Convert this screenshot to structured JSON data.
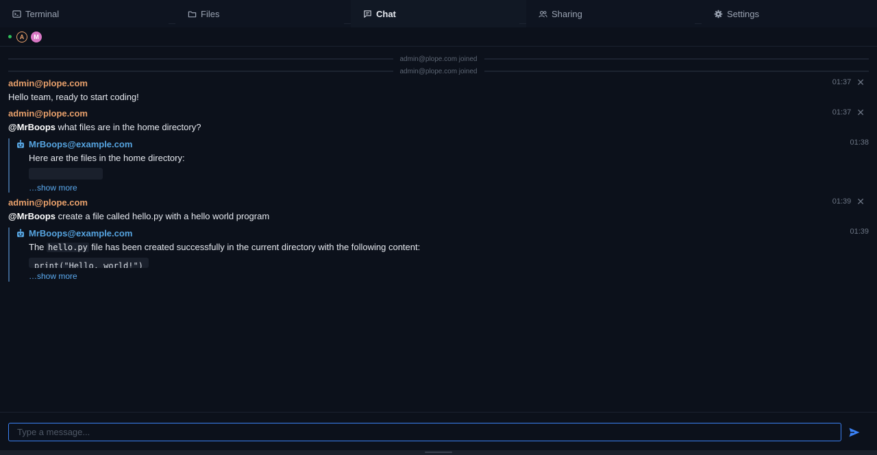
{
  "tabs": [
    {
      "label": "Terminal",
      "icon": "terminal-icon",
      "active": false
    },
    {
      "label": "Files",
      "icon": "folder-icon",
      "active": false
    },
    {
      "label": "Chat",
      "icon": "chat-icon",
      "active": true
    },
    {
      "label": "Sharing",
      "icon": "users-icon",
      "active": false
    },
    {
      "label": "Settings",
      "icon": "gear-icon",
      "active": false
    }
  ],
  "presence": {
    "status_color": "#2fbf5a",
    "avatars": [
      {
        "initial": "A",
        "color": "#e8a06b"
      },
      {
        "initial": "M",
        "color": "#d977c4"
      }
    ]
  },
  "system_messages": [
    "admin@plope.com joined",
    "admin@plope.com joined"
  ],
  "messages": [
    {
      "author": "admin@plope.com",
      "time": "01:37",
      "text": "Hello team, ready to start coding!"
    },
    {
      "author": "admin@plope.com",
      "time": "01:37",
      "mention": "@MrBoops",
      "text": " what files are in the home directory?"
    },
    {
      "bot": true,
      "author": "MrBoops@example.com",
      "time": "01:38",
      "text": "Here are the files in the home directory:",
      "show_more": "…show more"
    },
    {
      "author": "admin@plope.com",
      "time": "01:39",
      "mention": "@MrBoops",
      "text": " create a file called hello.py with a hello world program"
    },
    {
      "bot": true,
      "author": "MrBoops@example.com",
      "time": "01:39",
      "text_prefix": "The ",
      "inline_code": "hello.py",
      "text_suffix": " file has been created successfully in the current directory with the following content:",
      "code": "print(\"Hello, world!\")",
      "show_more": "…show more"
    }
  ],
  "composer": {
    "placeholder": "Type a message...",
    "accent": "#3b82f6"
  },
  "colors": {
    "user_author": "#e8a06b",
    "bot_author": "#56a4e0",
    "link": "#5aa9ee",
    "background": "#0c111b"
  }
}
